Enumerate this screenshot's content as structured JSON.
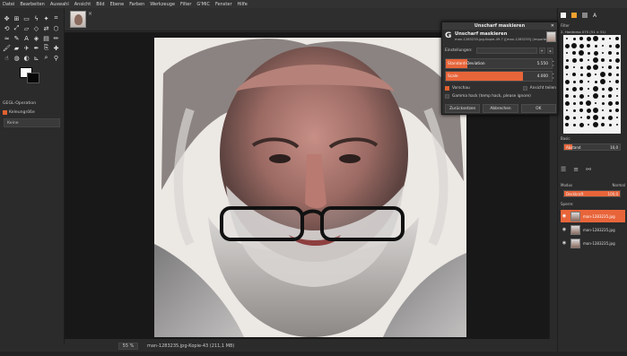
{
  "menu": [
    "Datei",
    "Bearbeiten",
    "Auswahl",
    "Ansicht",
    "Bild",
    "Ebene",
    "Farben",
    "Werkzeuge",
    "Filter",
    "G'MIC",
    "Fenster",
    "Hilfe"
  ],
  "image_tab": {
    "close": "×"
  },
  "tool_options": {
    "title": "GEGL-Operation",
    "option": "Keleungröße",
    "mode": "Keine"
  },
  "dialog": {
    "window_title": "Unscharf maskieren",
    "heading": "Unscharf maskieren",
    "subtitle": "man-1283235.jpg-Kopie-49.7 ([man-1283235] (imported))",
    "presets_label": "Einstellungen:",
    "sliders": [
      {
        "label": "Standard-Deviation",
        "value": "5.550",
        "fill": 0.2
      },
      {
        "label": "Scale",
        "value": "4.000",
        "fill": 0.73
      }
    ],
    "preview_label": "Vorschau",
    "split_label": "Ansicht teilen",
    "gamma_label": "Gamma hack (temp hack, please ignore)",
    "buttons": {
      "reset": "Zurücksetzen",
      "cancel": "Abbrechen",
      "ok": "OK"
    }
  },
  "status": {
    "zoom": "55 %",
    "file": "man-1283235.jpg-Kopie-43 (211,1 MB)"
  },
  "right_panel": {
    "brush_filter": "Filter",
    "brush_name": "2. Hardness 075 (51 × 51)",
    "basic_label": "Basic",
    "spacing": {
      "label": "Abstand",
      "value": "10,0",
      "fill": 0.15
    },
    "layers_mode_label": "Modus",
    "layers_mode_value": "Normal",
    "opacity": {
      "label": "Deckkraft",
      "value": "100,0",
      "fill": 1.0
    },
    "lock_label": "Sperre:",
    "layers": [
      {
        "name": "man-1283235.jpg",
        "active": true
      },
      {
        "name": "man-1283235.jpg",
        "active": false
      },
      {
        "name": "man-1283235.jpg",
        "active": false
      }
    ]
  },
  "colors": {
    "accent": "#e8653a",
    "canvas_bg": "#181818"
  }
}
